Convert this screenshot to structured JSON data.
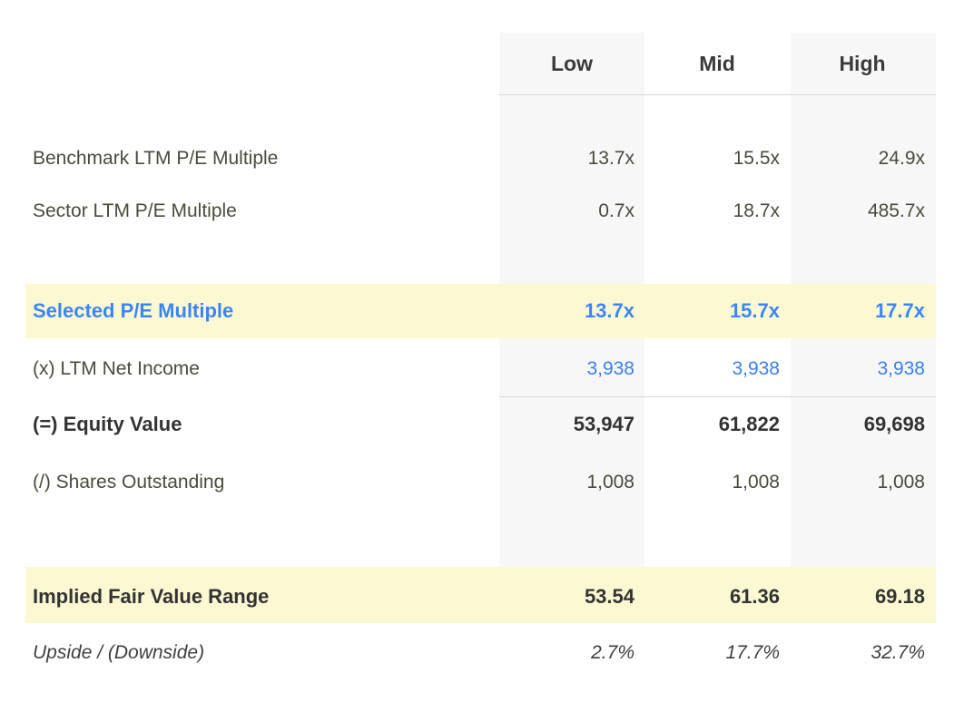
{
  "table": {
    "columns": [
      "Low",
      "Mid",
      "High"
    ],
    "rows": [
      {
        "label": "Benchmark LTM P/E Multiple",
        "values": [
          "13.7x",
          "15.5x",
          "24.9x"
        ]
      },
      {
        "label": "Sector LTM P/E Multiple",
        "values": [
          "0.7x",
          "18.7x",
          "485.7x"
        ]
      },
      {
        "label": "Selected P/E Multiple",
        "values": [
          "13.7x",
          "15.7x",
          "17.7x"
        ]
      },
      {
        "label": "(x) LTM Net Income",
        "values": [
          "3,938",
          "3,938",
          "3,938"
        ]
      },
      {
        "label": "(=) Equity Value",
        "values": [
          "53,947",
          "61,822",
          "69,698"
        ]
      },
      {
        "label": "(/) Shares Outstanding",
        "values": [
          "1,008",
          "1,008",
          "1,008"
        ]
      },
      {
        "label": "Implied Fair Value Range",
        "values": [
          "53.54",
          "61.36",
          "69.18"
        ]
      },
      {
        "label": "Upside / (Downside)",
        "values": [
          "2.7%",
          "17.7%",
          "32.7%"
        ]
      }
    ]
  },
  "colors": {
    "highlight_background": "#fcf8d2",
    "column_shading": "#f7f7f7",
    "accent_blue": "#3b86f7",
    "text_default": "#4b4a3d",
    "text_bold": "#333333",
    "rule": "#d9d9d9"
  }
}
